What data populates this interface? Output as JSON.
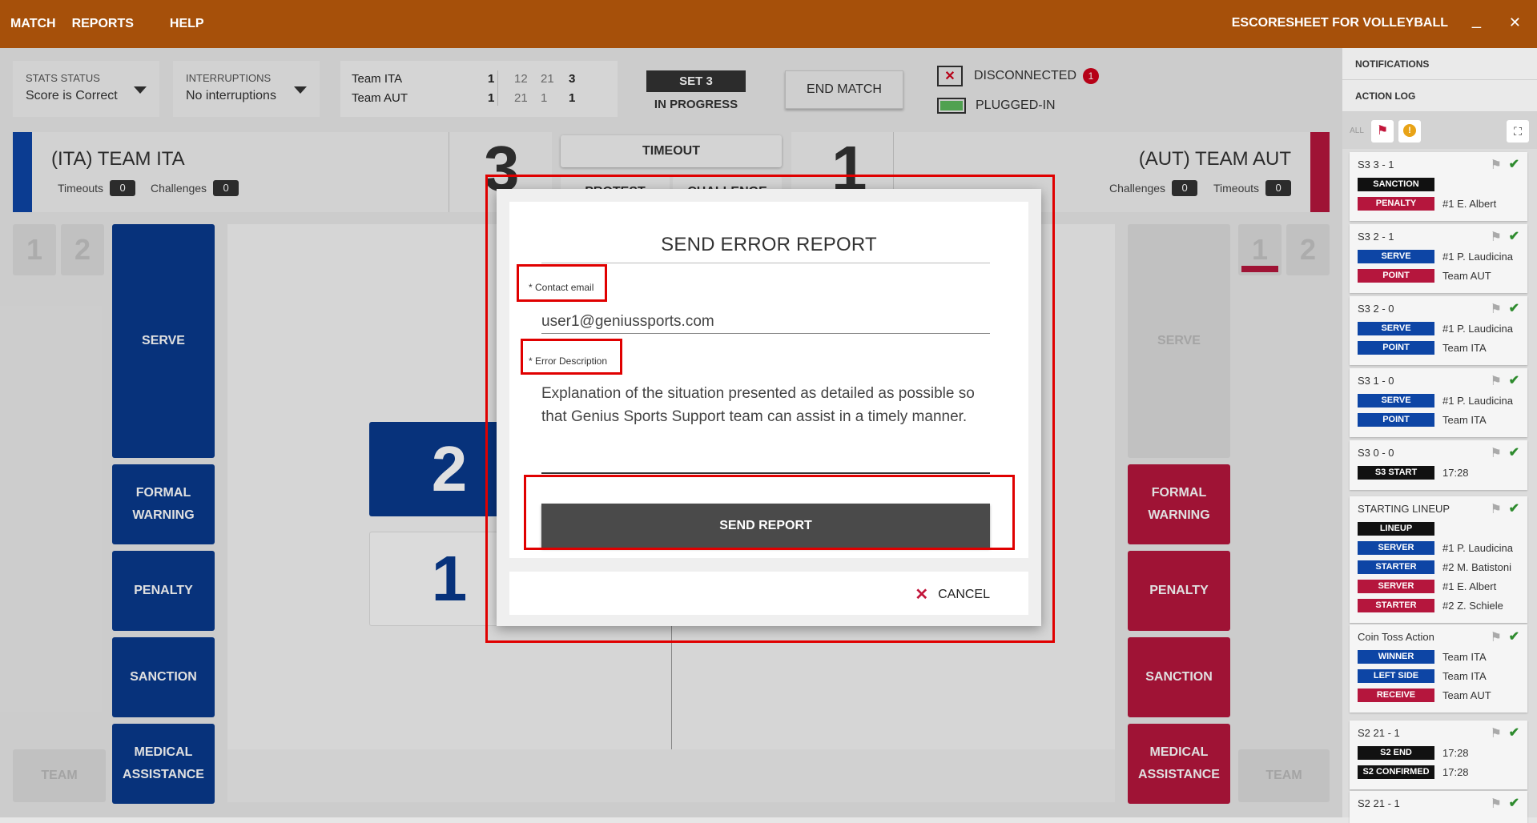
{
  "topbar": {
    "menu": [
      "MATCH",
      "REPORTS",
      "HELP"
    ],
    "title": "ESCORESHEET FOR VOLLEYBALL",
    "minimize": "_",
    "close": "✕"
  },
  "stats_status": {
    "label": "STATS STATUS",
    "value": "Score is Correct"
  },
  "interruptions": {
    "label": "INTERRUPTIONS",
    "value": "No interruptions"
  },
  "scoreboard": {
    "teams": [
      {
        "name": "Team ITA",
        "sets": "1",
        "s1": "12",
        "s2": "21",
        "s3": "3"
      },
      {
        "name": "Team AUT",
        "sets": "1",
        "s1": "21",
        "s2": "1",
        "s3": "1"
      }
    ]
  },
  "set_badge": "SET 3",
  "set_status": "IN PROGRESS",
  "end_match": "END MATCH",
  "connection": {
    "status": "DISCONNECTED",
    "count": "1",
    "power": "PLUGGED-IN"
  },
  "left_team": {
    "name": "(ITA) TEAM ITA",
    "timeouts_label": "Timeouts",
    "timeouts": "0",
    "challenges_label": "Challenges",
    "challenges": "0",
    "score": "3"
  },
  "right_team": {
    "name": "(AUT) TEAM AUT",
    "timeouts_label": "Timeouts",
    "timeouts": "0",
    "challenges_label": "Challenges",
    "challenges": "0",
    "score": "1"
  },
  "center_buttons": {
    "timeout": "TIMEOUT",
    "protest": "PROTEST",
    "challenge": "CHALLENGE"
  },
  "sets_nav": {
    "one": "1",
    "two": "2"
  },
  "court": {
    "left_score": "2",
    "right_score": "1"
  },
  "left_actions": {
    "serve": "SERVE",
    "formal_warning": "FORMAL WARNING",
    "penalty": "PENALTY",
    "sanction": "SANCTION",
    "medical": "MEDICAL ASSISTANCE",
    "team": "TEAM"
  },
  "right_actions": {
    "serve": "SERVE",
    "formal_warning": "FORMAL WARNING",
    "penalty": "PENALTY",
    "sanction": "SANCTION",
    "medical": "MEDICAL ASSISTANCE",
    "team": "TEAM"
  },
  "modal": {
    "title": "SEND ERROR REPORT",
    "email_label": "* Contact email",
    "email_value": "user1@geniussports.com",
    "desc_label": "* Error Description",
    "desc_value": "Explanation of the situation presented as detailed as possible so that Genius Sports Support team can assist in a timely manner.",
    "send": "SEND REPORT",
    "cancel": "CANCEL"
  },
  "sidebar": {
    "notifications": "NOTIFICATIONS",
    "action_log": "ACTION LOG",
    "filter_all": "ALL",
    "entries": [
      {
        "header": "S3  3 - 1",
        "lines": [
          [
            "SANCTION",
            "black",
            ""
          ],
          [
            "PENALTY",
            "red",
            "#1 E. Albert"
          ]
        ]
      },
      {
        "header": "S3  2 - 1",
        "lines": [
          [
            "SERVE",
            "blue",
            "#1 P. Laudicina"
          ],
          [
            "POINT",
            "red",
            "Team AUT"
          ]
        ]
      },
      {
        "header": "S3  2 - 0",
        "lines": [
          [
            "SERVE",
            "blue",
            "#1 P. Laudicina"
          ],
          [
            "POINT",
            "blue",
            "Team ITA"
          ]
        ]
      },
      {
        "header": "S3  1 - 0",
        "lines": [
          [
            "SERVE",
            "blue",
            "#1 P. Laudicina"
          ],
          [
            "POINT",
            "blue",
            "Team ITA"
          ]
        ]
      },
      {
        "header": "S3  0 - 0",
        "lines": [
          [
            "S3 START",
            "black",
            "17:28"
          ]
        ]
      },
      {
        "header": "STARTING LINEUP",
        "lines": [
          [
            "LINEUP",
            "black",
            ""
          ],
          [
            "SERVER",
            "blue",
            "#1 P. Laudicina"
          ],
          [
            "STARTER",
            "blue",
            "#2 M. Batistoni"
          ],
          [
            "SERVER",
            "red",
            "#1 E. Albert"
          ],
          [
            "STARTER",
            "red",
            "#2 Z. Schiele"
          ]
        ]
      },
      {
        "header": "Coin Toss Action",
        "lines": [
          [
            "WINNER",
            "blue",
            "Team ITA"
          ],
          [
            "LEFT SIDE",
            "blue",
            "Team ITA"
          ],
          [
            "RECEIVE",
            "red",
            "Team AUT"
          ]
        ]
      },
      {
        "header": "S2  21 - 1",
        "lines": [
          [
            "S2 END",
            "black",
            "17:28"
          ],
          [
            "S2 CONFIRMED",
            "black",
            "17:28"
          ]
        ]
      },
      {
        "header": "S2  21 - 1",
        "lines": []
      }
    ]
  }
}
